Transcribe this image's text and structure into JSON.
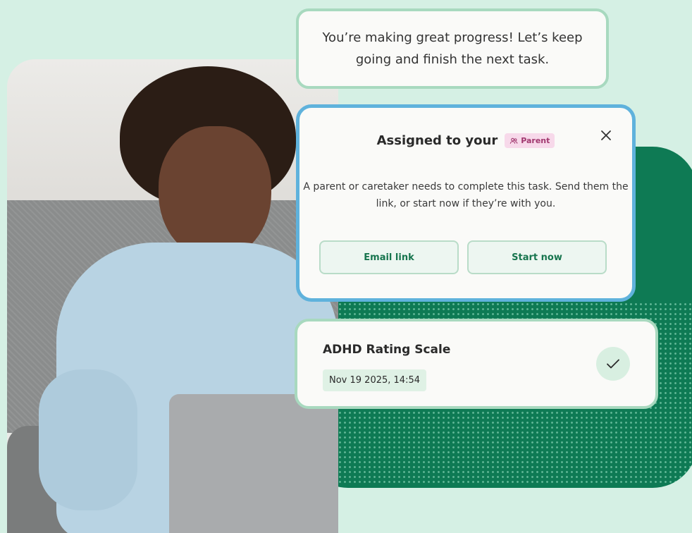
{
  "bubble": {
    "message": "You’re making great progress! Let’s keep going and finish the next task."
  },
  "assignment": {
    "title": "Assigned to your",
    "badge_label": "Parent",
    "badge_icon": "people-icon",
    "description": "A parent or caretaker needs to complete this task. Send them the link, or start now if they’re with you.",
    "email_button": "Email link",
    "start_button": "Start now",
    "close_icon": "close-icon"
  },
  "task": {
    "name": "ADHD Rating Scale",
    "date": "Nov 19 2025, 14:54",
    "status_icon": "checkmark-icon"
  },
  "colors": {
    "background": "#d5f0e4",
    "brand_green": "#0e7a54",
    "accent_blue": "#5fb2dc",
    "badge_bg": "#f7d9ea",
    "badge_text": "#a1386f",
    "button_text": "#17754e"
  }
}
